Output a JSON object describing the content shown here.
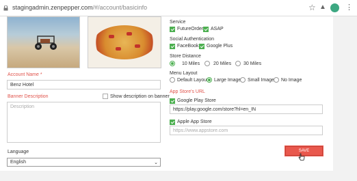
{
  "browser": {
    "url_host": "stagingadmin.zenpepper.com",
    "url_path": "/#/account/basicinfo",
    "icons": [
      "lock-icon",
      "star-icon",
      "extension-icon",
      "profile-icon",
      "menu-icon"
    ]
  },
  "form": {
    "account_name_label": "Account Name",
    "required_mark": "*",
    "account_name_value": "Benz Hotel",
    "banner_description_label": "Banner Description",
    "show_description_label": "Show description on banner",
    "description_placeholder": "Description",
    "language_label": "Language",
    "language_value": "English"
  },
  "settings": {
    "service_label": "Service",
    "service_options": [
      {
        "label": "FutureOrder",
        "checked": true
      },
      {
        "label": "ASAP",
        "checked": true
      }
    ],
    "social_auth_label": "Social Authentication",
    "social_options": [
      {
        "label": "FaceBook",
        "checked": true
      },
      {
        "label": "Google Plus",
        "checked": true
      }
    ],
    "store_distance_label": "Store Distance",
    "distance_options": [
      {
        "label": "10 Miles",
        "selected": true
      },
      {
        "label": "20 Miles",
        "selected": false
      },
      {
        "label": "30 Miles",
        "selected": false
      }
    ],
    "menu_layout_label": "Menu Layout",
    "layout_options": [
      {
        "label": "Default Layout",
        "selected": false
      },
      {
        "label": "Large Image",
        "selected": true
      },
      {
        "label": "Small Image",
        "selected": false
      },
      {
        "label": "No Image",
        "selected": false
      }
    ],
    "app_store_url_label": "App Store's URL",
    "google_play_label": "Google Play Store",
    "google_play_value": "https://play.google.com/store?hl=en_IN",
    "apple_store_label": "Apple App Store",
    "apple_store_placeholder": "https://www.appstore.com"
  },
  "actions": {
    "save_label": "SAVE"
  },
  "colors": {
    "accent_green": "#4caf50",
    "required_red": "#e0524a",
    "save_button": "#e9584d"
  }
}
